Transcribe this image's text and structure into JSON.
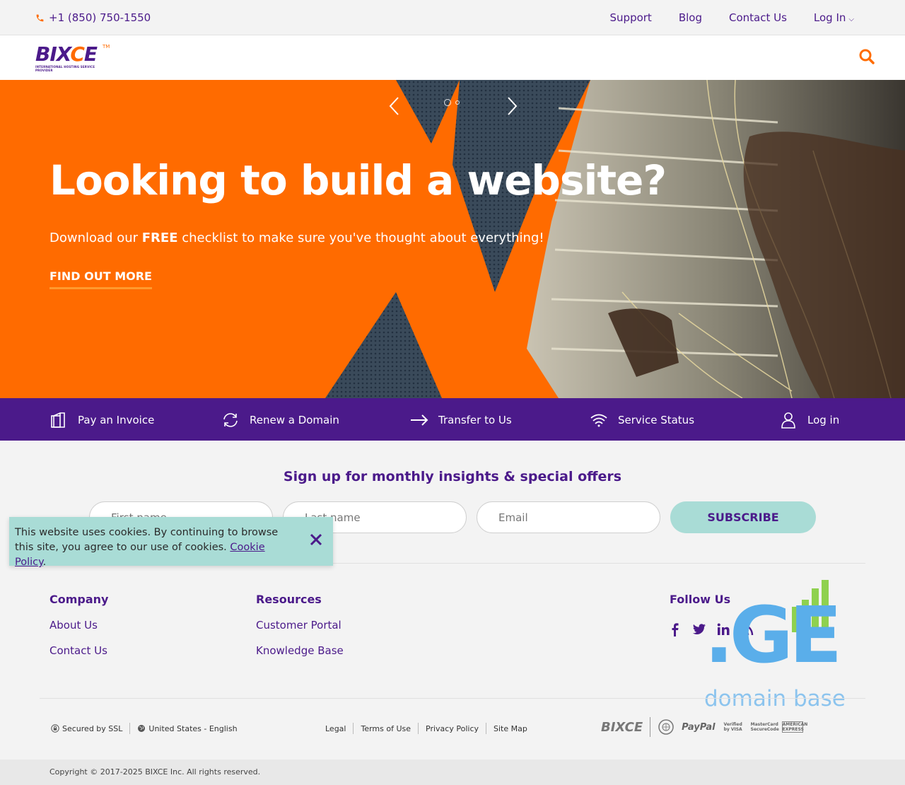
{
  "topbar": {
    "phone": "+1 (850) 750-1550",
    "nav": [
      "Support",
      "Blog",
      "Contact Us",
      "Log In"
    ]
  },
  "header": {
    "logo_text": "BIXCE",
    "logo_tag": "INTERNATIONAL HOSTING SERVICE PROVIDER",
    "logo_tm": "TM"
  },
  "hero": {
    "title": "Looking to build a website?",
    "subtitle_pre": "Download our ",
    "subtitle_bold": "FREE",
    "subtitle_post": " checklist to make sure you've thought about everything!",
    "cta": "FIND OUT MORE"
  },
  "quick_links": [
    {
      "label": "Pay an Invoice",
      "icon": "invoice-icon"
    },
    {
      "label": "Renew a Domain",
      "icon": "renew-icon"
    },
    {
      "label": "Transfer to Us",
      "icon": "arrow-right-icon"
    },
    {
      "label": "Service Status",
      "icon": "wifi-icon"
    },
    {
      "label": "Log in",
      "icon": "user-icon"
    }
  ],
  "newsletter": {
    "title": "Sign up for monthly insights & special offers",
    "first_name_placeholder": "First name",
    "last_name_placeholder": "Last name",
    "email_placeholder": "Email",
    "subscribe": "SUBSCRIBE"
  },
  "cookie": {
    "text": "This website uses cookies. By continuing to browse this site, you agree to our use of cookies. ",
    "link": "Cookie Policy",
    "end": "."
  },
  "footer": {
    "company": {
      "title": "Company",
      "links": [
        "About Us",
        "Contact Us"
      ]
    },
    "resources": {
      "title": "Resources",
      "links": [
        "Customer Portal",
        "Knowledge Base"
      ]
    },
    "follow": {
      "title": "Follow Us",
      "icons": [
        "facebook-icon",
        "twitter-icon",
        "linkedin-icon",
        "rss-icon"
      ]
    }
  },
  "watermark": {
    "ge": ".GE",
    "caption": "domain base"
  },
  "bottom": {
    "ssl": "Secured by SSL",
    "locale": "United States - English",
    "legal": [
      "Legal",
      "Terms of Use",
      "Privacy Policy",
      "Site Map"
    ],
    "badge_logo": "BIXCE",
    "paypal": "PayPal",
    "visa": "Verified by VISA",
    "mastercard": "MasterCard SecureCode",
    "amex": "AMERICAN EXPRESS"
  },
  "copyright": "Copyright © 2017-2025 BIXCE Inc. All rights reserved.",
  "colors": {
    "orange": "#ff6b00",
    "purple": "#4b1a8a",
    "mint": "#a9dcd6"
  }
}
